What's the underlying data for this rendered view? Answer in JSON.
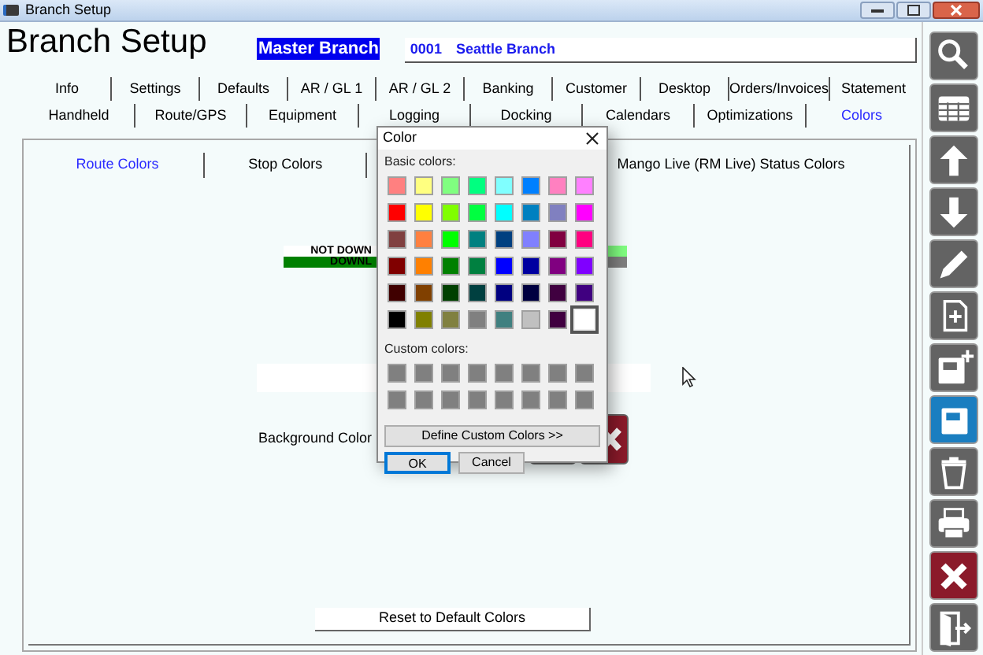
{
  "window": {
    "title": "Branch Setup"
  },
  "header": {
    "title": "Branch Setup",
    "branch_label": "Master Branch",
    "branch_code": "0001",
    "branch_name": "Seattle Branch"
  },
  "tab_rows": [
    {
      "tabs": [
        {
          "label": "Info",
          "selected": false
        },
        {
          "label": "Settings",
          "selected": false
        },
        {
          "label": "Defaults",
          "selected": false
        },
        {
          "label": "AR / GL 1",
          "selected": false
        },
        {
          "label": "AR / GL 2",
          "selected": false
        },
        {
          "label": "Banking",
          "selected": false
        },
        {
          "label": "Customer",
          "selected": false
        },
        {
          "label": "Desktop",
          "selected": false
        },
        {
          "label": "Orders/Invoices",
          "selected": false
        },
        {
          "label": "Statement",
          "selected": false
        }
      ]
    },
    {
      "tabs": [
        {
          "label": "Handheld",
          "selected": false
        },
        {
          "label": "Route/GPS",
          "selected": false
        },
        {
          "label": "Equipment",
          "selected": false
        },
        {
          "label": "Logging",
          "selected": false
        },
        {
          "label": "Docking",
          "selected": false
        },
        {
          "label": "Calendars",
          "selected": false
        },
        {
          "label": "Optimizations",
          "selected": false
        },
        {
          "label": "Colors",
          "selected": true
        }
      ]
    }
  ],
  "subtabs": [
    {
      "label": "Route Colors",
      "selected": true
    },
    {
      "label": "Stop Colors",
      "selected": false
    },
    {
      "label": "Mango Live (RM Live) Status Colors",
      "selected": false
    }
  ],
  "legend": [
    {
      "label": "NOT DOWN",
      "color": "#80ff80"
    },
    {
      "label": "DOWNL",
      "color": "#808080"
    }
  ],
  "background_color_label": "Background Color",
  "reset_button": "Reset to Default Colors",
  "toolbar": [
    {
      "kind": "search"
    },
    {
      "kind": "grid"
    },
    {
      "kind": "up"
    },
    {
      "kind": "down"
    },
    {
      "kind": "edit"
    },
    {
      "kind": "new"
    },
    {
      "kind": "save_new"
    },
    {
      "kind": "save"
    },
    {
      "kind": "delete"
    },
    {
      "kind": "print"
    },
    {
      "kind": "cancel"
    },
    {
      "kind": "exit"
    }
  ],
  "color_dialog": {
    "title": "Color",
    "basic_label": "Basic colors:",
    "basic_colors": [
      {
        "color": "#ff8080",
        "selected": false
      },
      {
        "color": "#ffff80",
        "selected": false
      },
      {
        "color": "#80ff80",
        "selected": false
      },
      {
        "color": "#00ff80",
        "selected": false
      },
      {
        "color": "#80ffff",
        "selected": false
      },
      {
        "color": "#0080ff",
        "selected": false
      },
      {
        "color": "#ff80c0",
        "selected": false
      },
      {
        "color": "#ff80ff",
        "selected": false
      },
      {
        "color": "#ff0000",
        "selected": false
      },
      {
        "color": "#ffff00",
        "selected": false
      },
      {
        "color": "#80ff00",
        "selected": false
      },
      {
        "color": "#00ff40",
        "selected": false
      },
      {
        "color": "#00ffff",
        "selected": false
      },
      {
        "color": "#0080c0",
        "selected": false
      },
      {
        "color": "#8080c0",
        "selected": false
      },
      {
        "color": "#ff00ff",
        "selected": false
      },
      {
        "color": "#804040",
        "selected": false
      },
      {
        "color": "#ff8040",
        "selected": false
      },
      {
        "color": "#00ff00",
        "selected": false
      },
      {
        "color": "#008080",
        "selected": false
      },
      {
        "color": "#004080",
        "selected": false
      },
      {
        "color": "#8080ff",
        "selected": false
      },
      {
        "color": "#800040",
        "selected": false
      },
      {
        "color": "#ff0080",
        "selected": false
      },
      {
        "color": "#800000",
        "selected": false
      },
      {
        "color": "#ff8000",
        "selected": false
      },
      {
        "color": "#008000",
        "selected": false
      },
      {
        "color": "#008040",
        "selected": false
      },
      {
        "color": "#0000ff",
        "selected": false
      },
      {
        "color": "#0000a0",
        "selected": false
      },
      {
        "color": "#800080",
        "selected": false
      },
      {
        "color": "#8000ff",
        "selected": false
      },
      {
        "color": "#400000",
        "selected": false
      },
      {
        "color": "#804000",
        "selected": false
      },
      {
        "color": "#004000",
        "selected": false
      },
      {
        "color": "#004040",
        "selected": false
      },
      {
        "color": "#000080",
        "selected": false
      },
      {
        "color": "#000040",
        "selected": false
      },
      {
        "color": "#400040",
        "selected": false
      },
      {
        "color": "#400080",
        "selected": false
      },
      {
        "color": "#000000",
        "selected": false
      },
      {
        "color": "#808000",
        "selected": false
      },
      {
        "color": "#808040",
        "selected": false
      },
      {
        "color": "#808080",
        "selected": false
      },
      {
        "color": "#408080",
        "selected": false
      },
      {
        "color": "#c0c0c0",
        "selected": false
      },
      {
        "color": "#400040",
        "selected": false
      },
      {
        "color": "#ffffff",
        "selected": true
      }
    ],
    "custom_label": "Custom colors:",
    "custom_colors": [
      {
        "color": "#808080"
      },
      {
        "color": "#808080"
      },
      {
        "color": "#808080"
      },
      {
        "color": "#808080"
      },
      {
        "color": "#808080"
      },
      {
        "color": "#808080"
      },
      {
        "color": "#808080"
      },
      {
        "color": "#808080"
      },
      {
        "color": "#808080"
      },
      {
        "color": "#808080"
      },
      {
        "color": "#808080"
      },
      {
        "color": "#808080"
      },
      {
        "color": "#808080"
      },
      {
        "color": "#808080"
      },
      {
        "color": "#808080"
      },
      {
        "color": "#808080"
      }
    ],
    "define_button": "Define Custom Colors >>",
    "buttons": [
      {
        "label": "OK",
        "selected": true
      },
      {
        "label": "Cancel",
        "selected": false
      }
    ]
  }
}
